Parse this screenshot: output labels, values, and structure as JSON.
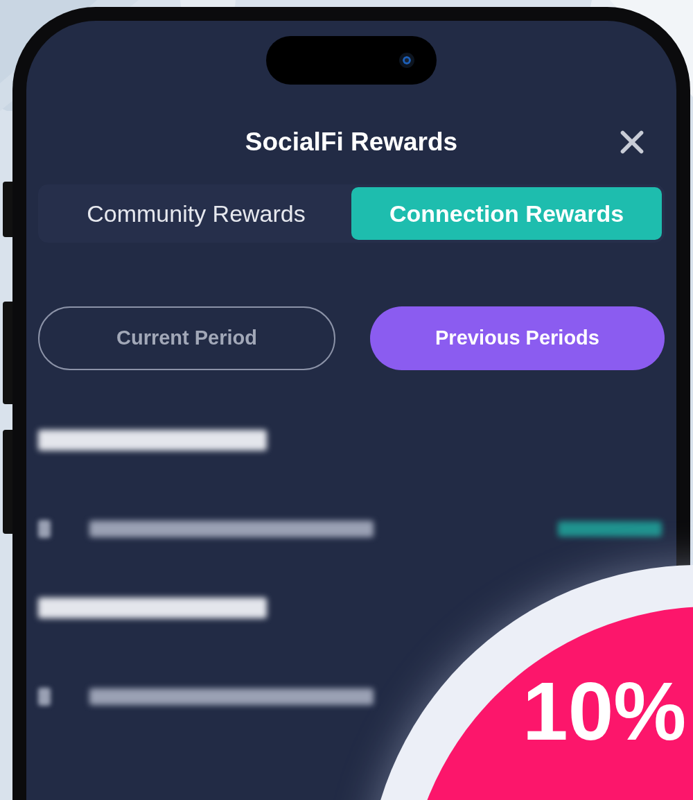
{
  "app": {
    "title": "SocialFi Rewards"
  },
  "tabs": [
    {
      "label": "Community Rewards",
      "selected": false
    },
    {
      "label": "Connection Rewards",
      "selected": true
    }
  ],
  "period_filters": [
    {
      "label": "Current Period",
      "selected": false
    },
    {
      "label": "Previous Periods",
      "selected": true
    }
  ],
  "periods": [
    {
      "entries": [
        {
          "kind": "full"
        }
      ]
    },
    {
      "entries": [
        {
          "kind": "covered"
        }
      ]
    }
  ],
  "badge": {
    "value": "10%"
  }
}
